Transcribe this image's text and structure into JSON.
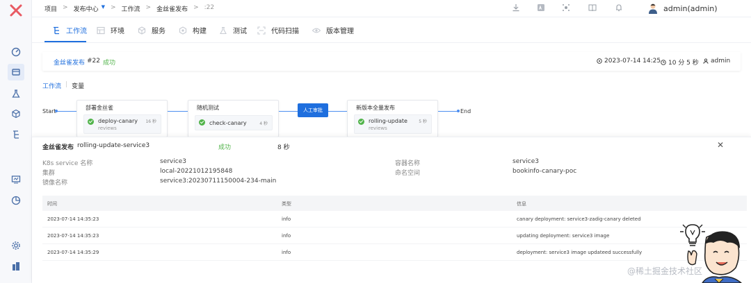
{
  "breadcrumb": {
    "project": "项目",
    "release_center": "发布中心",
    "workflow": "工作流",
    "workflow_name": "金丝雀发布",
    "run": ":22"
  },
  "user": {
    "name": "admin(admin)"
  },
  "tabs": [
    {
      "label": "工作流",
      "active": true
    },
    {
      "label": "环境"
    },
    {
      "label": "服务"
    },
    {
      "label": "构建"
    },
    {
      "label": "测试"
    },
    {
      "label": "代码扫描"
    },
    {
      "label": "版本管理"
    }
  ],
  "run_header": {
    "name": "金丝雀发布",
    "number": "#22",
    "status": "成功",
    "started_at": "2023-07-14 14:25",
    "duration": "10 分 5 秒",
    "creator": "admin"
  },
  "subtabs": {
    "workflow": "工作流",
    "variables": "变量"
  },
  "pipeline": {
    "start": "Start",
    "end": "End",
    "stages": [
      {
        "title": "部署金丝雀",
        "job": "deploy-canary",
        "time": "16 秒",
        "sub": "reviews"
      },
      {
        "title": "随机测试",
        "job": "check-canary",
        "time": "4 秒",
        "sub": ""
      },
      {
        "title": "新版本全量发布",
        "job": "rolling-update",
        "time": "5 秒",
        "sub": "reviews"
      }
    ],
    "approval": "人工审批"
  },
  "detail": {
    "title": "金丝雀发布",
    "job": "rolling-update-service3",
    "status": "成功",
    "duration": "8 秒",
    "fields": {
      "k8s_service_label": "K8s service 名称",
      "k8s_service": "service3",
      "container_label": "容器名称",
      "container": "service3",
      "cluster_label": "集群",
      "cluster": "local-20221012195848",
      "namespace_label": "命名空间",
      "namespace": "bookinfo-canary-poc",
      "image_label": "镜像名称",
      "image": "service3:20230711150004-234-main"
    },
    "log_table": {
      "headers": [
        "时间",
        "类型",
        "信息"
      ],
      "rows": [
        [
          "2023-07-14 14:35:23",
          "info",
          "canary deployment: service3-zadig-canary deleted"
        ],
        [
          "2023-07-14 14:35:23",
          "info",
          "updating deployment: service3 image"
        ],
        [
          "2023-07-14 14:35:29",
          "info",
          "deployment: service3 image updateed successfully"
        ]
      ]
    }
  },
  "watermark": "@稀土掘金技术社区",
  "colors": {
    "primary": "#1f6fde",
    "success": "#52b44b",
    "line": "#4c8ef0"
  }
}
